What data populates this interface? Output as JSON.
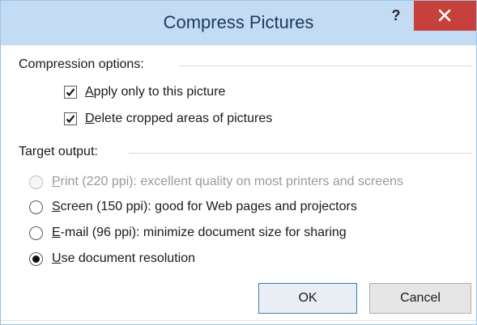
{
  "window": {
    "title": "Compress Pictures",
    "help_label": "?",
    "close_icon": "close-icon",
    "accent_color": "#c6413c",
    "titlebar_color": "#c3dcf3"
  },
  "compression": {
    "heading": "Compression options:",
    "options": [
      {
        "mnemonic": "A",
        "rest": "pply only to this picture",
        "checked": true
      },
      {
        "mnemonic": "D",
        "rest": "elete cropped areas of pictures",
        "checked": true
      }
    ]
  },
  "target": {
    "heading": "Target output:",
    "options": [
      {
        "mnemonic": "P",
        "rest": "rint (220 ppi): excellent quality on most printers and screens",
        "selected": false,
        "enabled": false
      },
      {
        "mnemonic": "S",
        "rest": "creen (150 ppi): good for Web pages and projectors",
        "selected": false,
        "enabled": true
      },
      {
        "mnemonic": "E",
        "rest": "-mail (96 ppi): minimize document size for sharing",
        "selected": false,
        "enabled": true
      },
      {
        "mnemonic": "U",
        "rest": "se document resolution",
        "selected": true,
        "enabled": true
      }
    ]
  },
  "buttons": {
    "ok_label": "OK",
    "cancel_label": "Cancel"
  }
}
